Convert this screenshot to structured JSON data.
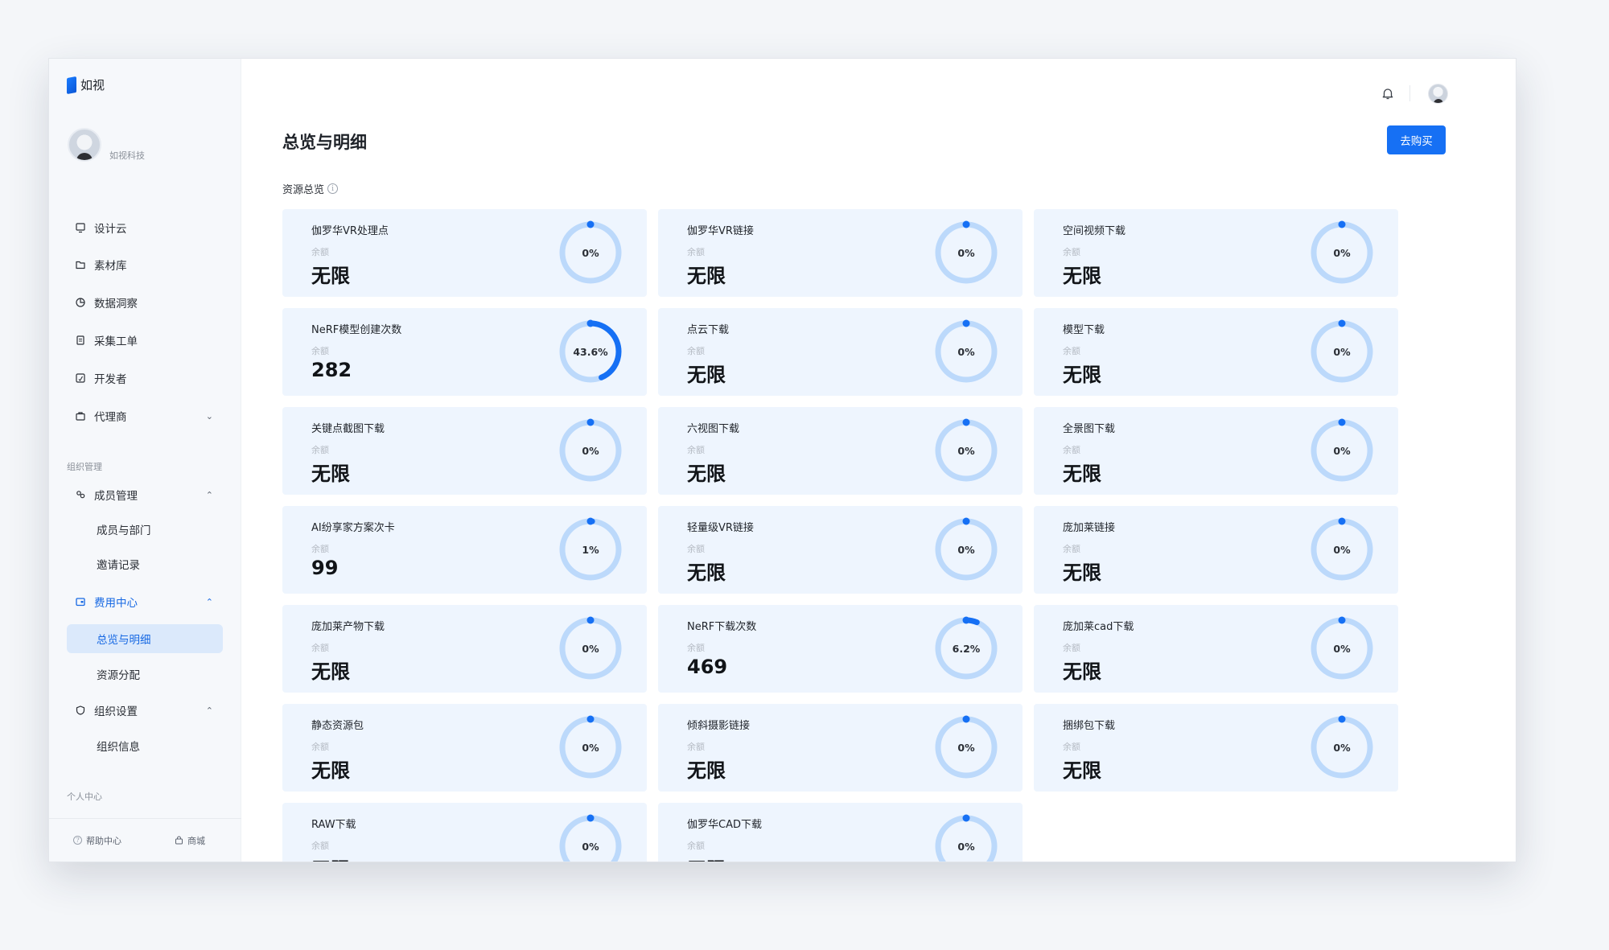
{
  "app": {
    "logo_text": "如视",
    "org_name": "如视科技"
  },
  "nav": {
    "items": [
      {
        "label": "设计云",
        "icon": "monitor-icon"
      },
      {
        "label": "素材库",
        "icon": "folder-icon"
      },
      {
        "label": "数据洞察",
        "icon": "pie-chart-icon"
      },
      {
        "label": "采集工单",
        "icon": "document-icon"
      },
      {
        "label": "开发者",
        "icon": "code-icon"
      },
      {
        "label": "代理商",
        "icon": "briefcase-icon"
      }
    ],
    "org_section_label": "组织管理",
    "member_mgmt": {
      "label": "成员管理",
      "children": [
        "成员与部门",
        "邀请记录"
      ]
    },
    "billing": {
      "label": "费用中心",
      "children": [
        "总览与明细",
        "资源分配"
      ],
      "selected": "总览与明细"
    },
    "org_settings": {
      "label": "组织设置",
      "children": [
        "组织信息"
      ]
    },
    "personal_section_label": "个人中心",
    "footer": {
      "help": "帮助中心",
      "shop": "商城"
    }
  },
  "header": {
    "title": "总览与明细",
    "buy_button": "去购买"
  },
  "overview": {
    "section_title": "资源总览",
    "balance_label": "余额",
    "cards": [
      {
        "title": "伽罗华VR处理点",
        "value": "无限",
        "percent": 0,
        "percent_label": "0%"
      },
      {
        "title": "伽罗华VR链接",
        "value": "无限",
        "percent": 0,
        "percent_label": "0%"
      },
      {
        "title": "空间视频下载",
        "value": "无限",
        "percent": 0,
        "percent_label": "0%"
      },
      {
        "title": "NeRF模型创建次数",
        "value": "282",
        "percent": 43.6,
        "percent_label": "43.6%"
      },
      {
        "title": "点云下载",
        "value": "无限",
        "percent": 0,
        "percent_label": "0%"
      },
      {
        "title": "模型下载",
        "value": "无限",
        "percent": 0,
        "percent_label": "0%"
      },
      {
        "title": "关键点截图下载",
        "value": "无限",
        "percent": 0,
        "percent_label": "0%"
      },
      {
        "title": "六视图下载",
        "value": "无限",
        "percent": 0,
        "percent_label": "0%"
      },
      {
        "title": "全景图下载",
        "value": "无限",
        "percent": 0,
        "percent_label": "0%"
      },
      {
        "title": "AI纷享家方案次卡",
        "value": "99",
        "percent": 1,
        "percent_label": "1%"
      },
      {
        "title": "轻量级VR链接",
        "value": "无限",
        "percent": 0,
        "percent_label": "0%"
      },
      {
        "title": "庞加莱链接",
        "value": "无限",
        "percent": 0,
        "percent_label": "0%"
      },
      {
        "title": "庞加莱产物下载",
        "value": "无限",
        "percent": 0,
        "percent_label": "0%"
      },
      {
        "title": "NeRF下载次数",
        "value": "469",
        "percent": 6.2,
        "percent_label": "6.2%"
      },
      {
        "title": "庞加莱cad下载",
        "value": "无限",
        "percent": 0,
        "percent_label": "0%"
      },
      {
        "title": "静态资源包",
        "value": "无限",
        "percent": 0,
        "percent_label": "0%"
      },
      {
        "title": "倾斜摄影链接",
        "value": "无限",
        "percent": 0,
        "percent_label": "0%"
      },
      {
        "title": "捆绑包下载",
        "value": "无限",
        "percent": 0,
        "percent_label": "0%"
      },
      {
        "title": "RAW下载",
        "value": "无限",
        "percent": 0,
        "percent_label": "0%"
      },
      {
        "title": "伽罗华CAD下载",
        "value": "无限",
        "percent": 0,
        "percent_label": "0%"
      }
    ]
  },
  "colors": {
    "accent": "#1670f4",
    "ring_track": "#bcd9fb",
    "ring_progress": "#1670f4",
    "card_bg": "#eef5fe"
  }
}
